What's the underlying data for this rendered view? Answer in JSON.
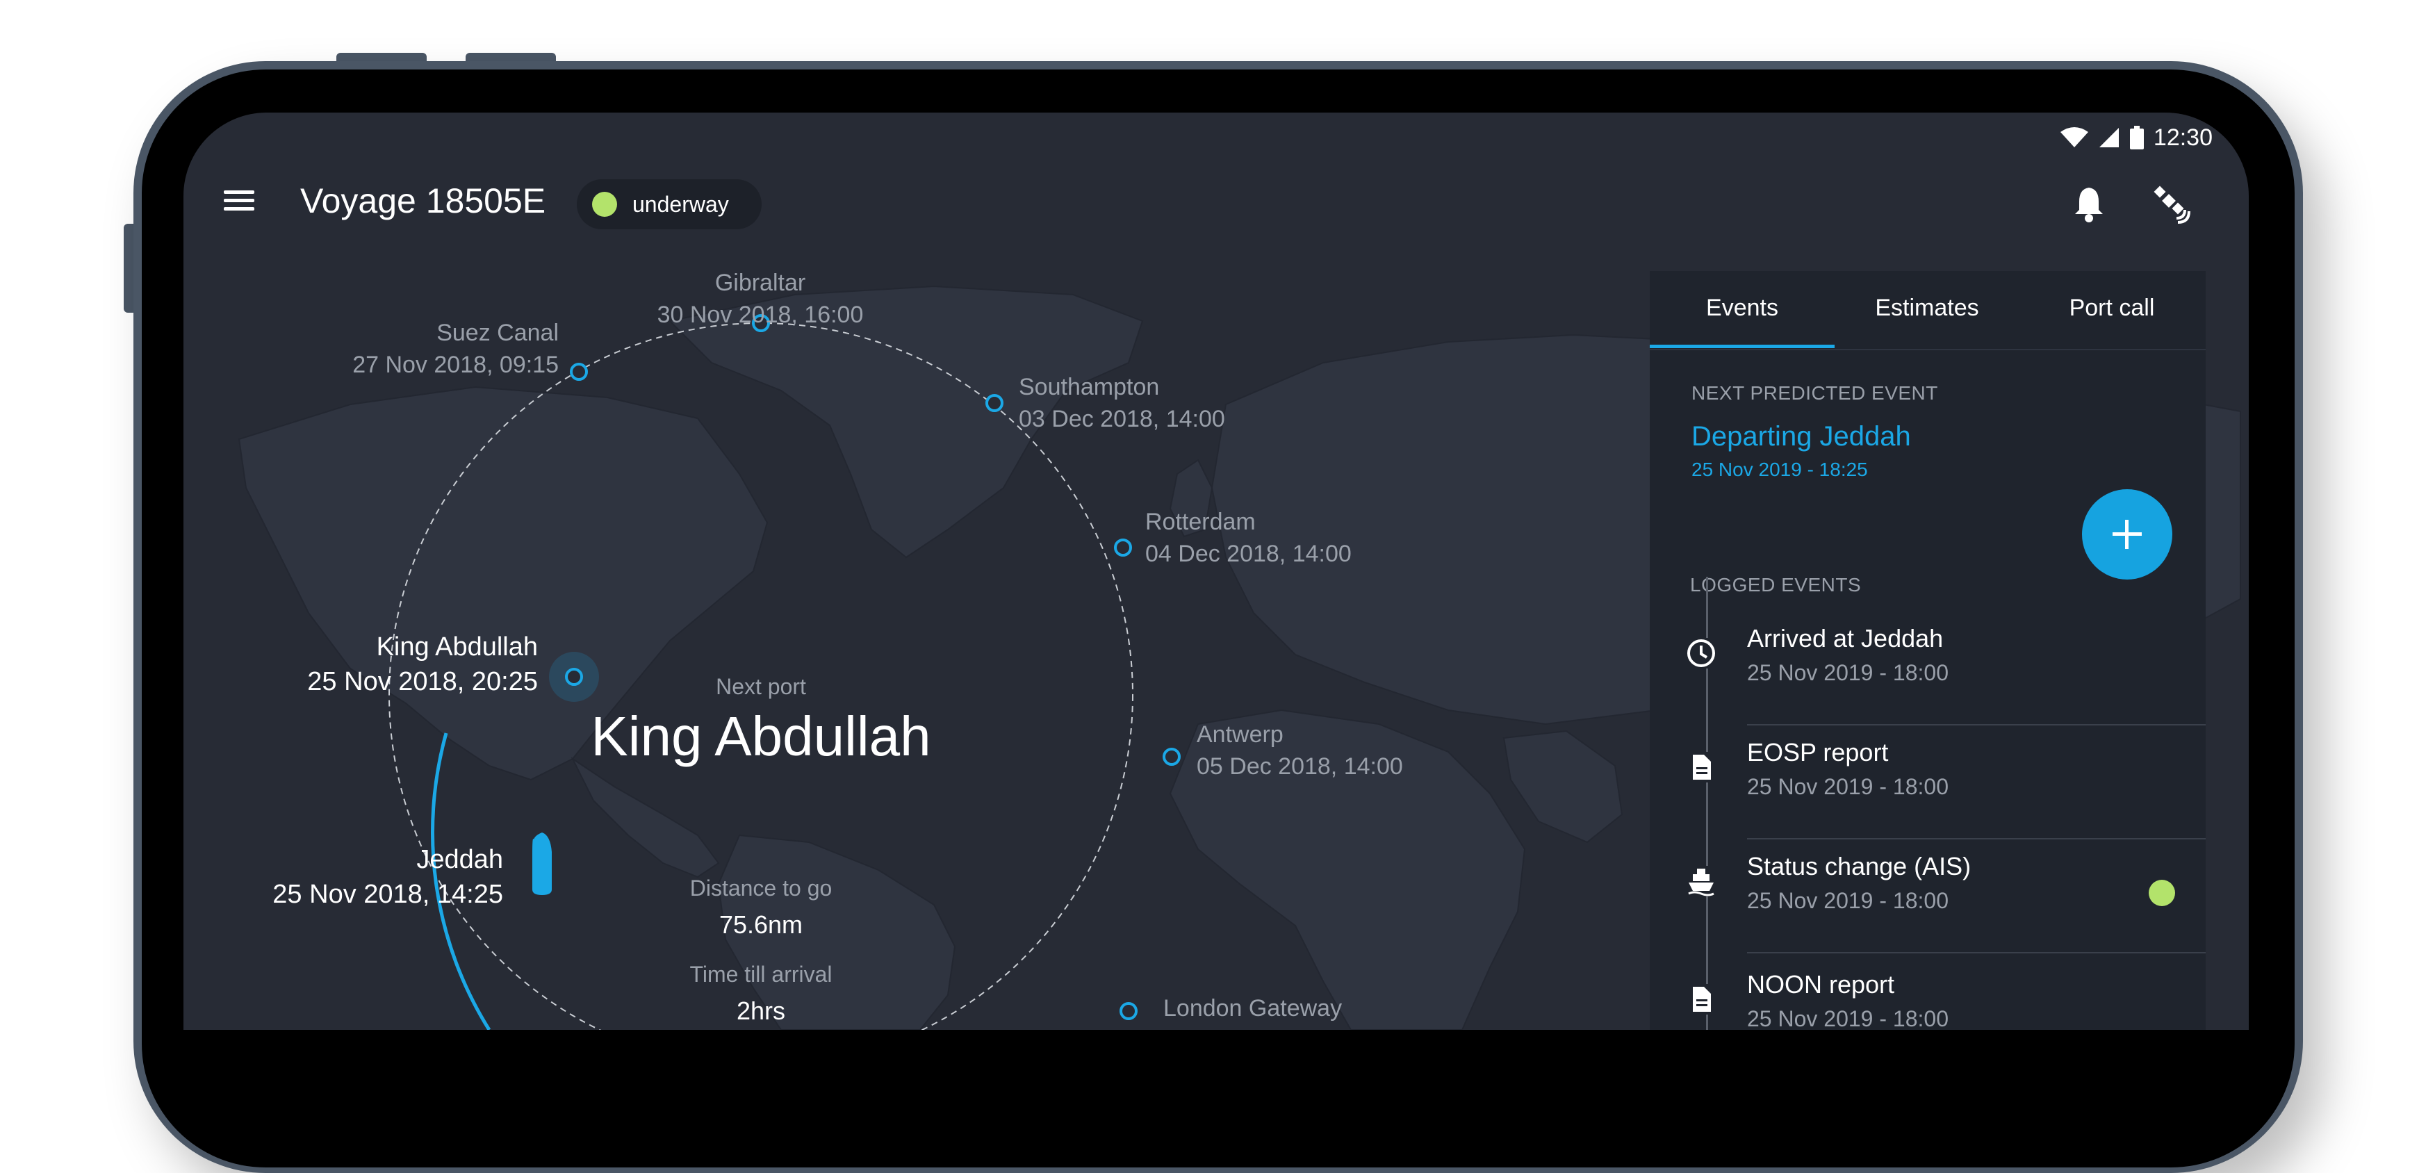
{
  "statusbar": {
    "time": "12:30"
  },
  "header": {
    "title": "Voyage 18505E",
    "status": "underway"
  },
  "colors": {
    "accent": "#1ba8e6",
    "status_green": "#b3e36b",
    "background": "#272b35",
    "panel": "#1f242d"
  },
  "icons": {
    "menu": "menu-icon",
    "bell": "bell-icon",
    "satellite": "satellite-icon",
    "wifi": "wifi-icon",
    "signal": "signal-icon",
    "battery": "battery-icon"
  },
  "map": {
    "center": {
      "label": "Next port",
      "port": "King Abdullah",
      "distance_label": "Distance to go",
      "distance": "75.6nm",
      "time_label": "Time till arrival",
      "time": "2hrs"
    },
    "waypoints": [
      {
        "name": "Gibraltar",
        "time": "30 Nov 2018, 16:00"
      },
      {
        "name": "Suez Canal",
        "time": "27 Nov 2018, 09:15"
      },
      {
        "name": "Southampton",
        "time": "03 Dec 2018, 14:00"
      },
      {
        "name": "Rotterdam",
        "time": "04 Dec 2018, 14:00"
      },
      {
        "name": "King Abdullah",
        "time": "25 Nov 2018, 20:25"
      },
      {
        "name": "Antwerp",
        "time": "05 Dec 2018, 14:00"
      },
      {
        "name": "Jeddah",
        "time": "25 Nov 2018, 14:25"
      },
      {
        "name": "London Gateway",
        "time": ""
      }
    ]
  },
  "panel": {
    "tabs": [
      {
        "label": "Events"
      },
      {
        "label": "Estimates"
      },
      {
        "label": "Port call"
      }
    ],
    "next_label": "NEXT PREDICTED EVENT",
    "next_title": "Departing Jeddah",
    "next_time": "25 Nov 2019 - 18:25",
    "logged_label": "LOGGED EVENTS",
    "events": [
      {
        "title": "Arrived at Jeddah",
        "time": "25 Nov 2019 - 18:00",
        "icon": "clock-icon"
      },
      {
        "title": "EOSP report",
        "time": "25 Nov 2019 - 18:00",
        "icon": "document-icon"
      },
      {
        "title": "Status change (AIS)",
        "time": "25 Nov 2019 - 18:00",
        "icon": "ship-icon"
      },
      {
        "title": "NOON report",
        "time": "25 Nov 2019 - 18:00",
        "icon": "document-icon"
      }
    ]
  }
}
